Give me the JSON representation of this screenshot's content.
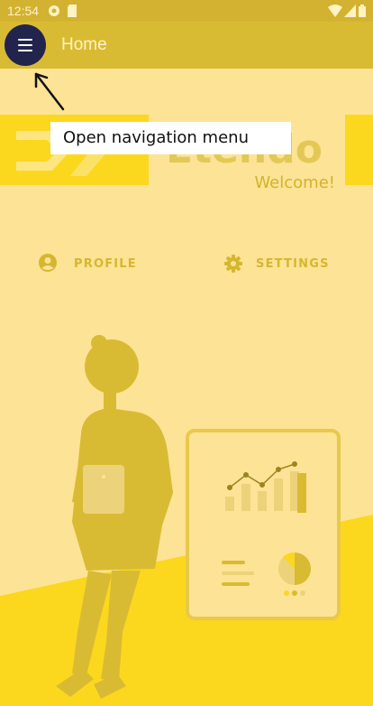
{
  "status_bar": {
    "time": "12:54",
    "icons": [
      "notification-icon",
      "sd-card-icon",
      "wifi-icon",
      "signal-icon",
      "battery-icon"
    ]
  },
  "app_bar": {
    "title": "Home",
    "menu_icon": "hamburger-menu-icon"
  },
  "tooltip": {
    "text": "Open navigation menu"
  },
  "hero": {
    "brand_partial": "Etendo",
    "welcome": "Welcome!"
  },
  "nav": {
    "profile_label": "PROFILE",
    "settings_label": "SETTINGS",
    "profile_icon": "account-circle-icon",
    "settings_icon": "gear-icon"
  },
  "colors": {
    "accent": "#fbd81e",
    "app_bar": "#d9bb33",
    "background": "#fde396",
    "menu_button": "#22244e"
  }
}
